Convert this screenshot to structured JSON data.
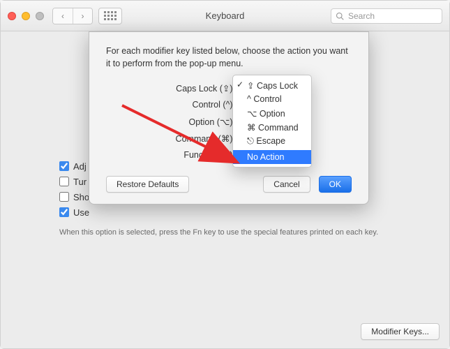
{
  "toolbar": {
    "title": "Keyboard",
    "search_placeholder": "Search"
  },
  "background": {
    "checkboxes": [
      {
        "label": "Adj",
        "checked": true
      },
      {
        "label": "Tur",
        "checked": false
      },
      {
        "label": "Sho",
        "checked": false
      },
      {
        "label": "Use",
        "checked": true
      }
    ],
    "note": "When this option is selected, press the Fn key to use the special features printed on each key.",
    "modifier_button": "Modifier Keys..."
  },
  "sheet": {
    "message": "For each modifier key listed below, choose the action you want it to perform from the pop-up menu.",
    "rows": [
      "Caps Lock (⇪) Key:",
      "Control (^) Key:",
      "Option (⌥) Key:",
      "Command (⌘) Key:",
      "Function (fn) Key:"
    ],
    "restore": "Restore Defaults",
    "cancel": "Cancel",
    "ok": "OK"
  },
  "popup": {
    "options": [
      "⇪ Caps Lock",
      "^ Control",
      "⌥ Option",
      "⌘ Command",
      "⎋ Escape"
    ],
    "selected": "No Action"
  }
}
